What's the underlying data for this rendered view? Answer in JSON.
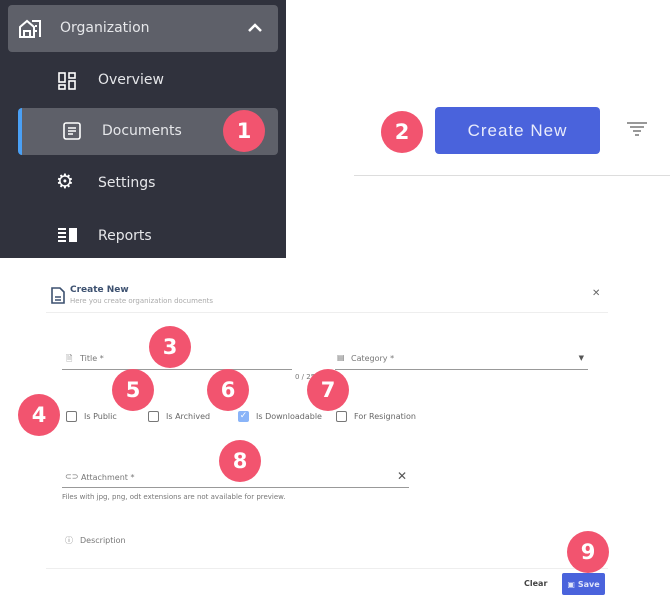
{
  "sidebar": {
    "group": "Organization",
    "items": [
      {
        "label": "Overview",
        "icon": "dashboard-icon"
      },
      {
        "label": "Documents",
        "icon": "document-icon",
        "active": true
      },
      {
        "label": "Settings",
        "icon": "gear-icon"
      },
      {
        "label": "Reports",
        "icon": "reports-icon"
      }
    ]
  },
  "toolbar": {
    "create_label": "Create New",
    "filter_icon": "filter-icon"
  },
  "badges": [
    "1",
    "2",
    "3",
    "4",
    "5",
    "6",
    "7",
    "8",
    "9"
  ],
  "dialog": {
    "title": "Create New",
    "subtitle": "Here you create organization documents",
    "title_label": "Title *",
    "title_counter": "0 / 255",
    "category_label": "Category *",
    "checkboxes": [
      {
        "label": "Is Public",
        "checked": false
      },
      {
        "label": "Is Archived",
        "checked": false
      },
      {
        "label": "Is Downloadable",
        "checked": true
      },
      {
        "label": "For Resignation",
        "checked": false
      }
    ],
    "attachment_label": "Attachment *",
    "attachment_hint": "Files with jpg, png, odt extensions are not available for preview.",
    "description_label": "Description",
    "clear_label": "Clear",
    "save_label": "Save"
  },
  "colors": {
    "accent": "#4a63dc",
    "badge": "#f2546f",
    "sidebar_bg": "#30323d",
    "active_bar": "#4aa0f5"
  }
}
